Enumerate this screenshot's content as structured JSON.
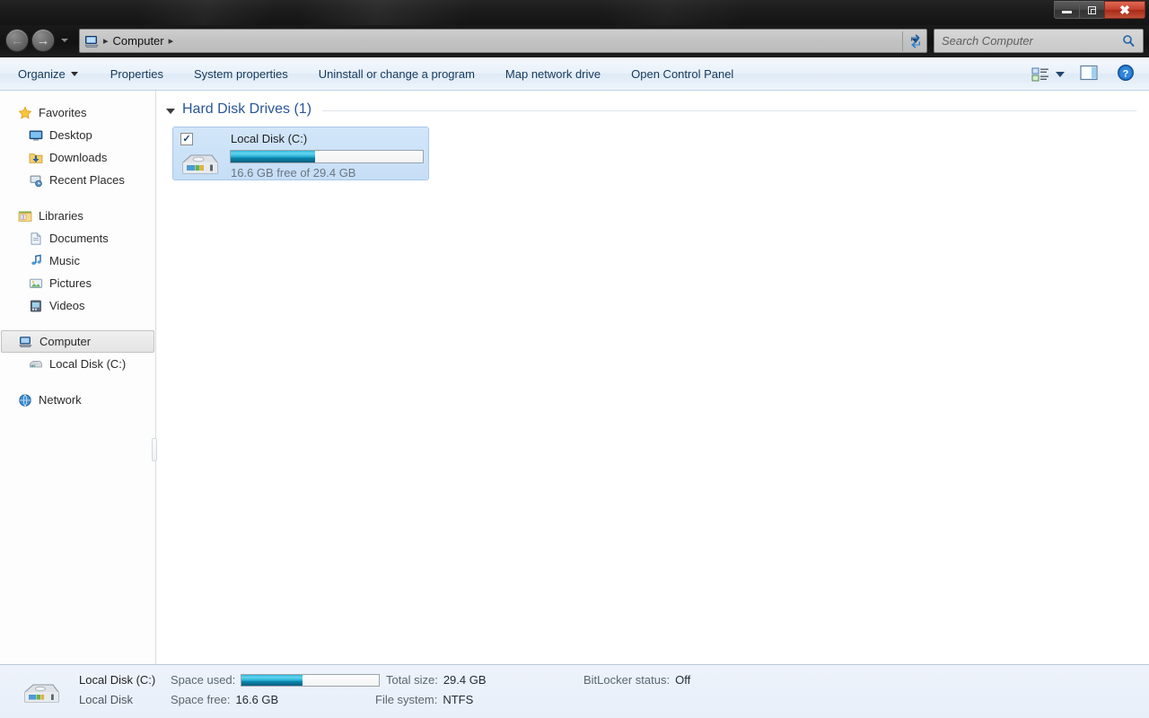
{
  "window": {
    "minimize_label": "Minimize",
    "restore_label": "Restore",
    "close_label": "Close"
  },
  "addressbar": {
    "root_label": "Computer",
    "separator": "▸",
    "icon": "computer-icon",
    "refresh_icon": "refresh-icon"
  },
  "search": {
    "placeholder": "Search Computer",
    "icon": "search-icon"
  },
  "toolbar": {
    "items": [
      {
        "label": "Organize",
        "has_caret": true
      },
      {
        "label": "Properties",
        "has_caret": false
      },
      {
        "label": "System properties",
        "has_caret": false
      },
      {
        "label": "Uninstall or change a program",
        "has_caret": false
      },
      {
        "label": "Map network drive",
        "has_caret": false
      },
      {
        "label": "Open Control Panel",
        "has_caret": false
      }
    ],
    "view_icon": "view-options-icon",
    "pane_icon": "preview-pane-icon",
    "help_icon": "help-icon"
  },
  "sidebar": {
    "groups": [
      {
        "header": {
          "label": "Favorites",
          "icon": "star-icon"
        },
        "items": [
          {
            "label": "Desktop",
            "icon": "desktop-icon"
          },
          {
            "label": "Downloads",
            "icon": "downloads-folder-icon"
          },
          {
            "label": "Recent Places",
            "icon": "recent-places-icon"
          }
        ]
      },
      {
        "header": {
          "label": "Libraries",
          "icon": "libraries-icon"
        },
        "items": [
          {
            "label": "Documents",
            "icon": "documents-library-icon"
          },
          {
            "label": "Music",
            "icon": "music-library-icon"
          },
          {
            "label": "Pictures",
            "icon": "pictures-library-icon"
          },
          {
            "label": "Videos",
            "icon": "videos-library-icon"
          }
        ]
      },
      {
        "header": {
          "label": "Computer",
          "icon": "computer-icon",
          "selected": true
        },
        "items": [
          {
            "label": "Local Disk (C:)",
            "icon": "hard-disk-icon"
          }
        ]
      },
      {
        "header": {
          "label": "Network",
          "icon": "network-icon"
        },
        "items": []
      }
    ]
  },
  "content": {
    "group_title": "Hard Disk Drives (1)",
    "drive": {
      "name": "Local Disk (C:)",
      "free_text": "16.6 GB free of 29.4 GB",
      "used_percent": 44,
      "checked": true,
      "selected": true,
      "icon": "hard-disk-icon"
    }
  },
  "statusbar": {
    "title": "Local Disk (C:)",
    "subtitle": "Local Disk",
    "icon": "hard-disk-icon",
    "fields": [
      {
        "label": "Space used:",
        "value": ""
      },
      {
        "label": "Space free:",
        "value": "16.6 GB"
      },
      {
        "label": "Total size:",
        "value": "29.4 GB"
      },
      {
        "label": "File system:",
        "value": "NTFS"
      },
      {
        "label": "BitLocker status:",
        "value": "Off"
      }
    ],
    "used_percent": 44
  },
  "colors": {
    "accent_blue": "#2a5699",
    "bar_cyan": "#2ab0d6",
    "bar_dark": "#0c5f80",
    "selection": "#cadff5",
    "close_red": "#c4402c"
  }
}
